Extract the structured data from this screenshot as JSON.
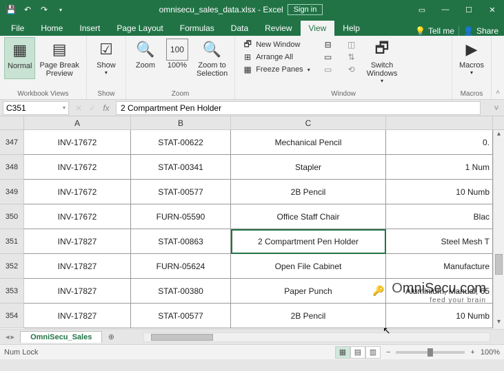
{
  "title": {
    "filename": "omnisecu_sales_data.xlsx",
    "app": "Excel",
    "sign_in": "Sign in"
  },
  "tabs": {
    "file": "File",
    "list": [
      "Home",
      "Insert",
      "Page Layout",
      "Formulas",
      "Data",
      "Review",
      "View",
      "Help"
    ],
    "active": "View",
    "tell_me": "Tell me",
    "share": "Share"
  },
  "ribbon": {
    "workbook_views": {
      "label": "Workbook Views",
      "normal": "Normal",
      "page_break": "Page Break\nPreview"
    },
    "show": {
      "label": "Show",
      "btn": "Show"
    },
    "zoom": {
      "label": "Zoom",
      "zoom": "Zoom",
      "hundred": "100%",
      "selection": "Zoom to\nSelection"
    },
    "window": {
      "label": "Window",
      "new_window": "New Window",
      "arrange_all": "Arrange All",
      "freeze_panes": "Freeze Panes",
      "switch": "Switch\nWindows"
    },
    "macros": {
      "label": "Macros",
      "btn": "Macros"
    }
  },
  "formula": {
    "name_box": "C351",
    "value": "2 Compartment Pen Holder"
  },
  "columns": [
    "A",
    "B",
    "C"
  ],
  "rows": [
    {
      "n": "347",
      "a": "INV-17672",
      "b": "STAT-00622",
      "c": "Mechanical Pencil",
      "d": "0."
    },
    {
      "n": "348",
      "a": "INV-17672",
      "b": "STAT-00341",
      "c": "Stapler",
      "d": "1 Num"
    },
    {
      "n": "349",
      "a": "INV-17672",
      "b": "STAT-00577",
      "c": "2B Pencil",
      "d": "10 Numb"
    },
    {
      "n": "350",
      "a": "INV-17672",
      "b": "FURN-05590",
      "c": "Office Staff Chair",
      "d": "Blac"
    },
    {
      "n": "351",
      "a": "INV-17827",
      "b": "STAT-00863",
      "c": "2 Compartment Pen Holder",
      "d": "Steel Mesh T",
      "sel": true
    },
    {
      "n": "352",
      "a": "INV-17827",
      "b": "FURN-05624",
      "c": "Open File Cabinet",
      "d": "Manufacture"
    },
    {
      "n": "353",
      "a": "INV-17827",
      "b": "STAT-00380",
      "c": "Paper Punch",
      "d": "Aluminium, Manual, 65"
    },
    {
      "n": "354",
      "a": "INV-17827",
      "b": "STAT-00577",
      "c": "2B Pencil",
      "d": "10 Numb"
    }
  ],
  "sheet": {
    "name": "OmniSecu_Sales"
  },
  "status": {
    "left": "Num Lock",
    "zoom": "100%"
  },
  "watermark": {
    "main_pre": "O",
    "main_rest": "mniSecu.com",
    "sub": "feed your brain"
  }
}
